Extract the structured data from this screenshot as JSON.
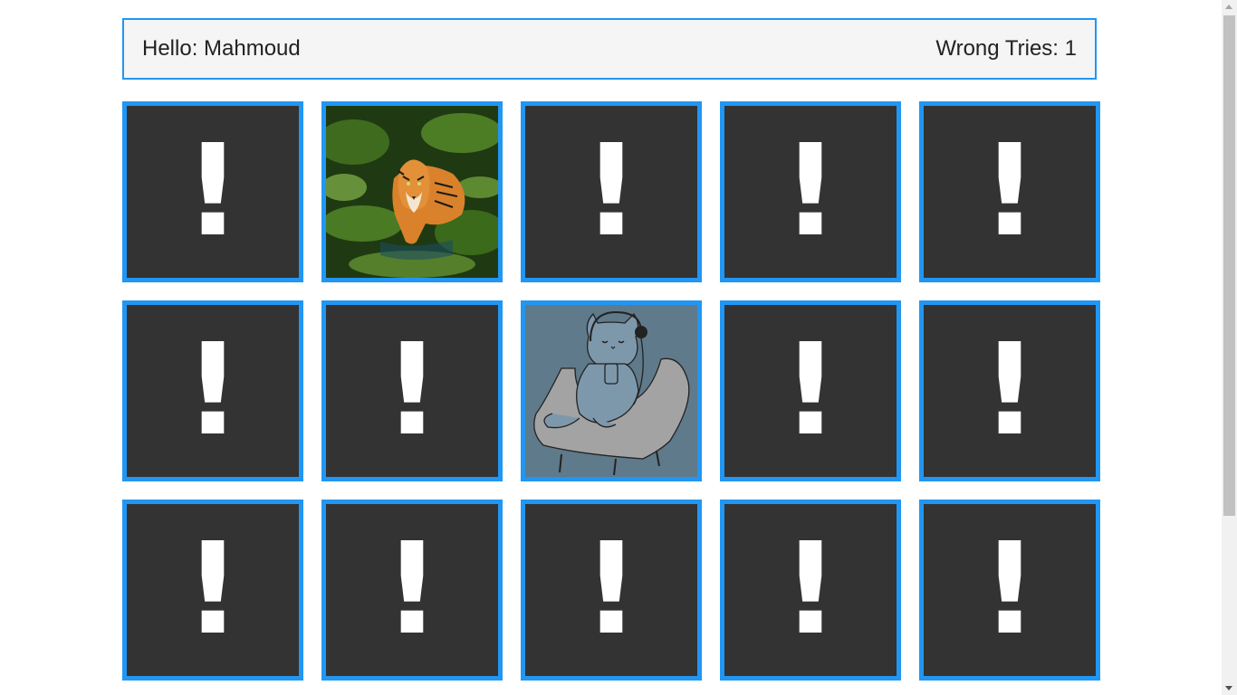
{
  "header": {
    "greeting": "Hello: Mahmoud",
    "wrong_tries": "Wrong Tries: 1"
  },
  "card_back_symbol": "!",
  "cards": [
    {
      "state": "hidden"
    },
    {
      "state": "revealed",
      "image": "tiger-photo"
    },
    {
      "state": "hidden"
    },
    {
      "state": "hidden"
    },
    {
      "state": "hidden"
    },
    {
      "state": "hidden"
    },
    {
      "state": "hidden"
    },
    {
      "state": "revealed",
      "image": "cat-headphones-illustration"
    },
    {
      "state": "hidden"
    },
    {
      "state": "hidden"
    },
    {
      "state": "hidden"
    },
    {
      "state": "hidden"
    },
    {
      "state": "hidden"
    },
    {
      "state": "hidden"
    },
    {
      "state": "hidden"
    }
  ],
  "colors": {
    "accent": "#2196f3",
    "card_back": "#333333",
    "header_bg": "#f5f5f5"
  }
}
